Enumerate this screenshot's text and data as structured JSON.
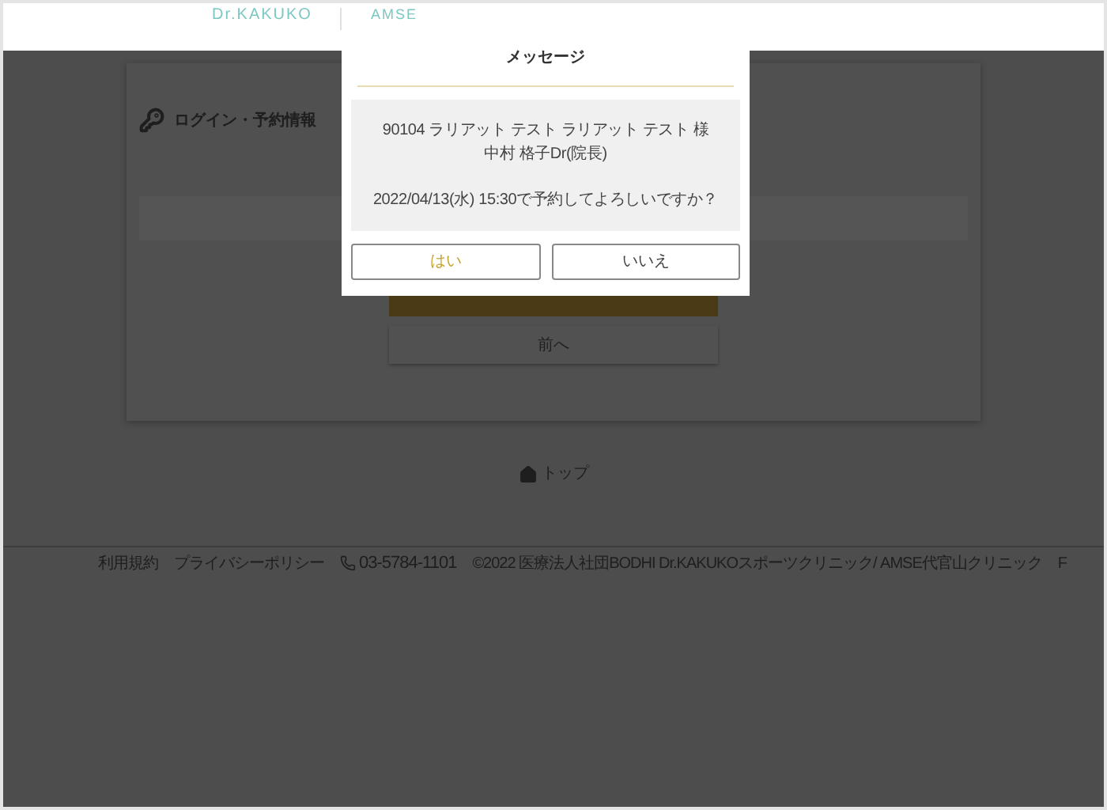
{
  "header": {
    "logo_primary": "Dr.KAKUKO",
    "logo_secondary": "AMSE"
  },
  "page": {
    "section_title": "ログイン・予約情報",
    "back_button": "前へ",
    "top_link": "トップ"
  },
  "footer": {
    "links": [
      "利用規約",
      "プライバシーポリシー"
    ],
    "phone": "03-5784-1101",
    "copyright": "©2022 医療法人社団BODHI Dr.KAKUKOスポーツクリニック/ AMSE代官山クリニック",
    "cut_text": "F"
  },
  "dialog": {
    "title": "メッセージ",
    "paragraphs": [
      [
        "90104 ラリアット テスト ラリアット テスト 様",
        "中村 格子Dr(院長)"
      ],
      [
        "2022/04/13(水) 15:30で予約してよろしいですか？"
      ]
    ],
    "buttons": [
      {
        "label": "はい",
        "kind": "confirm"
      },
      {
        "label": "いいえ",
        "kind": "cancel"
      }
    ]
  }
}
